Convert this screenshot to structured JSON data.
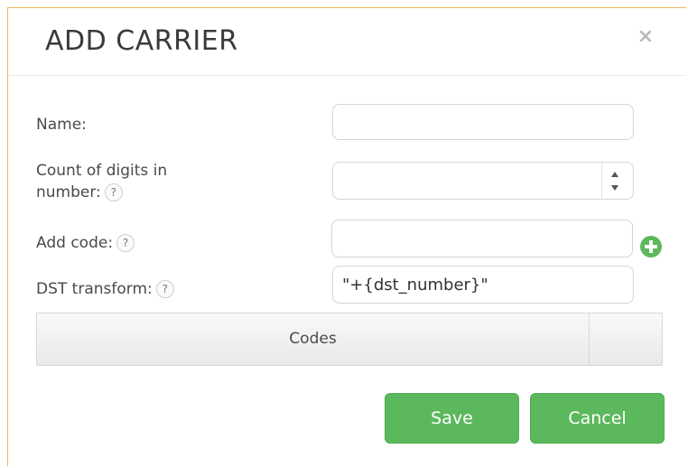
{
  "dialog": {
    "title": "ADD CARRIER",
    "close_glyph": "×"
  },
  "form": {
    "name": {
      "label": "Name:",
      "value": ""
    },
    "count_digits": {
      "label_line1": "Count of digits in",
      "label_line2": "number:",
      "help": "?",
      "value": ""
    },
    "add_code": {
      "label": "Add code:",
      "help": "?",
      "value": ""
    },
    "dst_transform": {
      "label": "DST transform:",
      "help": "?",
      "value": "\"+{dst_number}\""
    }
  },
  "codes_table": {
    "header": "Codes"
  },
  "buttons": {
    "save": "Save",
    "cancel": "Cancel"
  },
  "colors": {
    "accent_green": "#5cb85c",
    "dialog_border": "#f0b85a"
  }
}
